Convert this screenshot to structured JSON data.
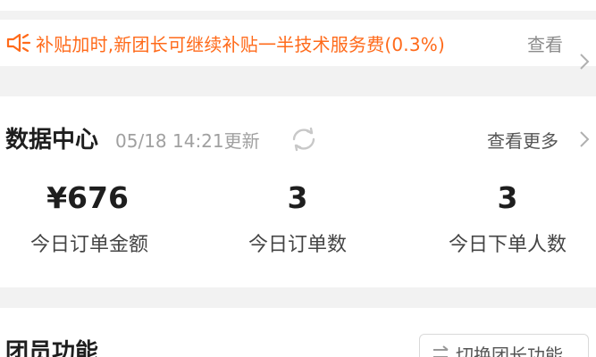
{
  "notice": {
    "text": "补贴加时,新团长可继续补贴一半技术服务费(0.3%)",
    "more_label": "查看",
    "icon": "megaphone-icon",
    "accent_color": "#ff6a1a"
  },
  "data_center": {
    "title": "数据中心",
    "updated_text": "05/18 14:21更新",
    "more_label": "查看更多",
    "stats": [
      {
        "value": "¥676",
        "label": "今日订单金额"
      },
      {
        "value": "3",
        "label": "今日订单数"
      },
      {
        "value": "3",
        "label": "今日下单人数"
      }
    ]
  },
  "member_functions": {
    "title": "团员功能",
    "switch_label": "切换团长功能",
    "switch_icon": "swap-icon"
  }
}
